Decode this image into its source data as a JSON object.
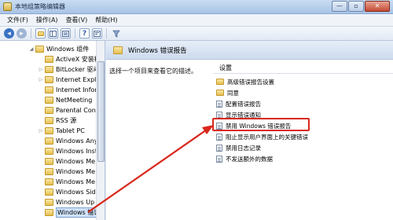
{
  "window": {
    "title": "本地组策略编辑器",
    "buttons": {
      "minimize": "—",
      "maximize": "▫",
      "close": "✕"
    }
  },
  "menu": [
    "文件(F)",
    "操作(A)",
    "查看(V)",
    "帮助(H)"
  ],
  "toolbar": {
    "back": "◂",
    "forward": "▸"
  },
  "tree": {
    "items": [
      {
        "label": "Windows 组件",
        "level": 0,
        "expanded": true
      },
      {
        "label": "ActiveX 安装程",
        "level": 1
      },
      {
        "label": "BitLocker 驱动",
        "level": 1
      },
      {
        "label": "Internet Explo",
        "level": 1
      },
      {
        "label": "Internet Infor",
        "level": 1
      },
      {
        "label": "NetMeeting",
        "level": 1
      },
      {
        "label": "Parental Cont",
        "level": 1
      },
      {
        "label": "RSS 源",
        "level": 1
      },
      {
        "label": "Tablet PC",
        "level": 1
      },
      {
        "label": "Windows Any",
        "level": 1
      },
      {
        "label": "Windows Inst",
        "level": 1
      },
      {
        "label": "Windows Me",
        "level": 1
      },
      {
        "label": "Windows Me",
        "level": 1
      },
      {
        "label": "Windows Me",
        "level": 1
      },
      {
        "label": "Windows Sid",
        "level": 1
      },
      {
        "label": "Windows Up",
        "level": 1
      },
      {
        "label": "Windows 错误",
        "level": 1,
        "selected": true
      }
    ]
  },
  "content": {
    "banner_title": "Windows 错误报告",
    "description": "选择一个项目来查看它的描述。",
    "settings_header": "设置",
    "settings": [
      {
        "label": "高级错误报告设置",
        "type": "folder"
      },
      {
        "label": "同意",
        "type": "folder"
      },
      {
        "label": "配置错误报告",
        "type": "policy"
      },
      {
        "label": "显示错误通知",
        "type": "policy"
      },
      {
        "label": "禁用 Windows 错误报告",
        "type": "policy",
        "highlighted": true
      },
      {
        "label": "阻止显示用户界面上的关键错误",
        "type": "policy"
      },
      {
        "label": "禁用日志记录",
        "type": "policy"
      },
      {
        "label": "不发送额外的数据",
        "type": "policy"
      }
    ]
  },
  "colors": {
    "annotation": "#d9281c",
    "selection": "#cfe3fb"
  }
}
